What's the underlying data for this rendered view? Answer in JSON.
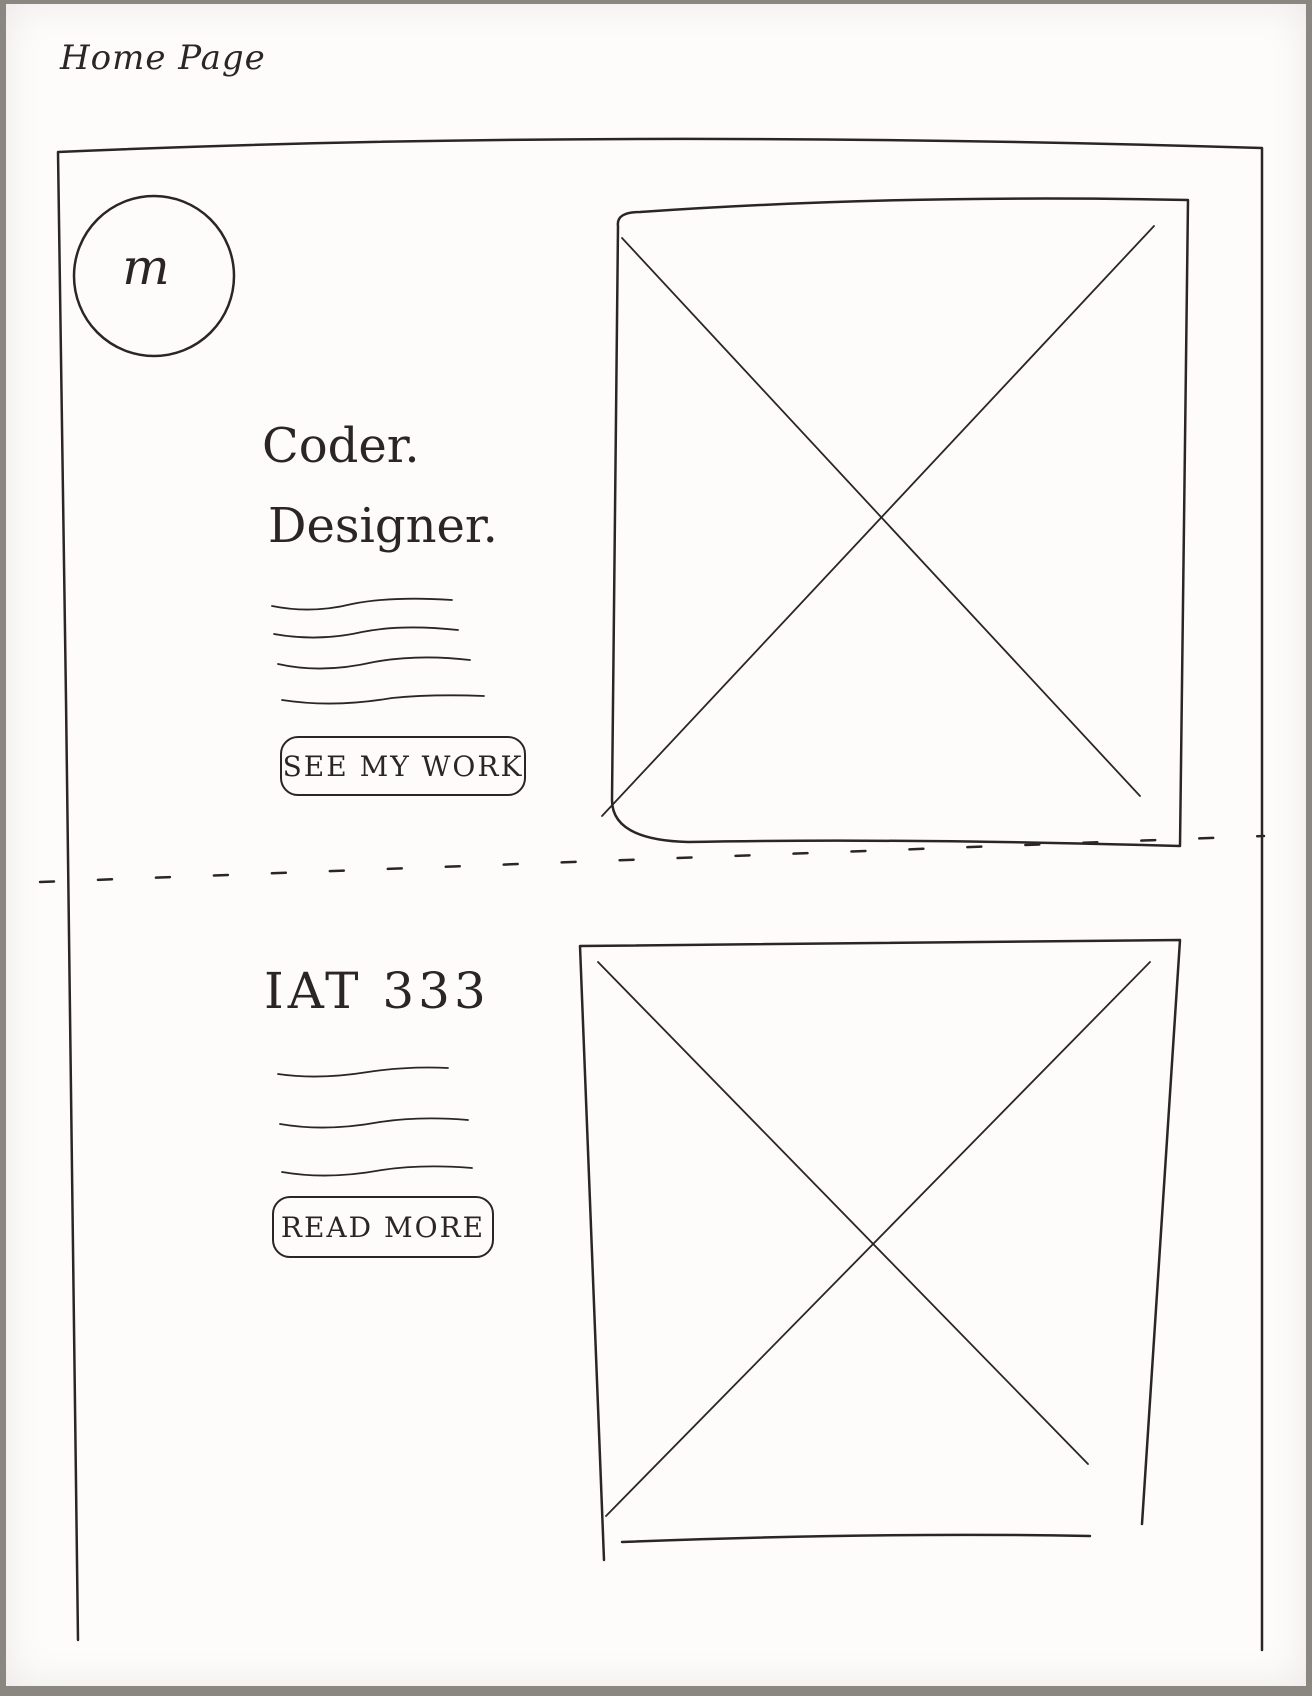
{
  "page": {
    "title": "Home Page"
  },
  "logo": {
    "letter": "m"
  },
  "hero": {
    "headline_line1": "Coder.",
    "headline_line2": "Designer.",
    "button_label": "SEE MY WORK",
    "image_icon": "image-placeholder-icon"
  },
  "course": {
    "title": "IAT 333",
    "button_label": "READ MORE",
    "image_icon": "image-placeholder-icon"
  },
  "colors": {
    "ink": "#2b2623",
    "paper": "#fdfcfa"
  }
}
